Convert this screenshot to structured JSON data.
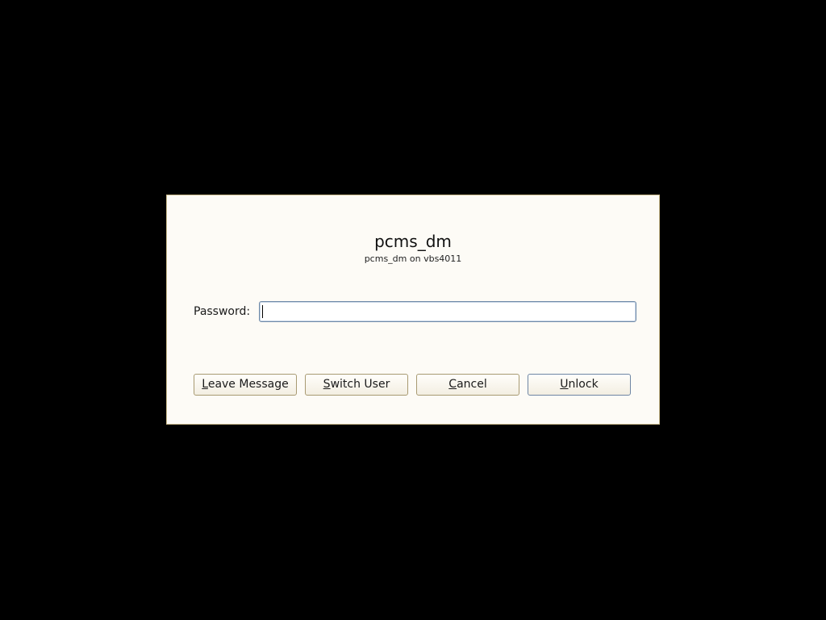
{
  "dialog": {
    "user_name": "pcms_dm",
    "user_host": "pcms_dm on vbs4011",
    "password_label": "Password:",
    "password_value": ""
  },
  "buttons": {
    "leave_message": {
      "mnemonic": "L",
      "rest": "eave Message"
    },
    "switch_user": {
      "mnemonic": "S",
      "rest": "witch User"
    },
    "cancel": {
      "mnemonic": "C",
      "rest": "ancel"
    },
    "unlock": {
      "mnemonic": "U",
      "rest": "nlock"
    }
  },
  "colors": {
    "background": "#000000",
    "dialog_bg": "#fdfbf6",
    "dialog_border": "#c9b98a",
    "input_focus_border": "#6f8aa8"
  }
}
